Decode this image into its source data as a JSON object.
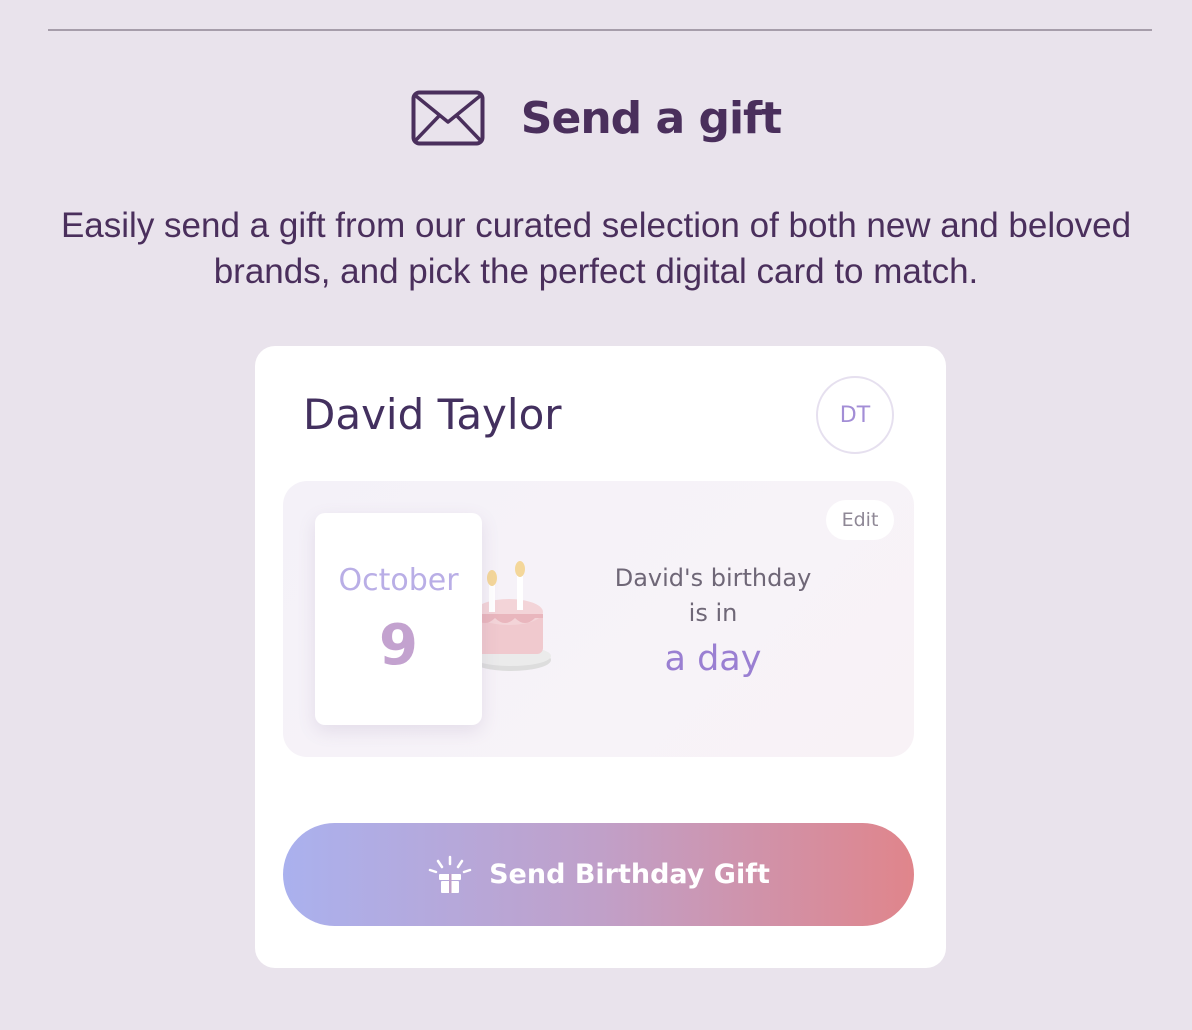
{
  "header": {
    "title": "Send a gift",
    "icon": "envelope-icon"
  },
  "intro": {
    "text": "Easily send a gift from our curated selection of both new and beloved brands, and pick the perfect digital card to match."
  },
  "card": {
    "name": "David Taylor",
    "initials": "DT",
    "edit_label": "Edit",
    "date": {
      "month": "October",
      "day": "9"
    },
    "birthday": {
      "line1": "David's birthday",
      "line2": "is in",
      "when": "a day"
    },
    "gift_button": {
      "label": "Send Birthday Gift",
      "icon": "gift-icon"
    }
  },
  "colors": {
    "background": "#e9e3ec",
    "text": "#4a2f5c",
    "accent": "#9a7fd2",
    "button_gradient_start": "#aab1ee",
    "button_gradient_end": "#e0858b"
  }
}
